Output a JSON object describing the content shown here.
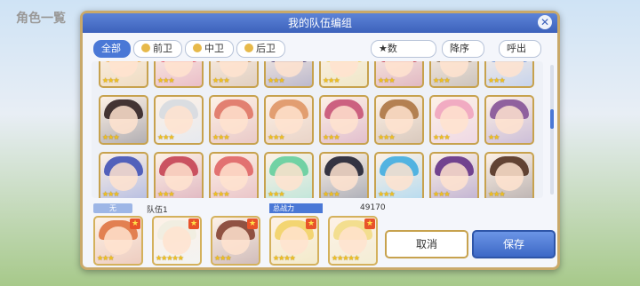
{
  "background": {
    "title": "角色一覧"
  },
  "dialog": {
    "title": "我的队伍编组",
    "filters": [
      {
        "label": "全部",
        "active": true
      },
      {
        "label": "前卫",
        "active": false
      },
      {
        "label": "中卫",
        "active": false
      },
      {
        "label": "后卫",
        "active": false
      }
    ],
    "sort_field": "★数",
    "sort_order": "降序",
    "call_label": "呼出"
  },
  "grid": {
    "rows": [
      [
        {
          "hair": "#f0b35a",
          "stars": "★★★"
        },
        {
          "hair": "#e25a6b",
          "stars": "★★★"
        },
        {
          "hair": "#c78c55",
          "stars": "★★★"
        },
        {
          "hair": "#5a4a78",
          "stars": "★★★"
        },
        {
          "hair": "#f2d36b",
          "stars": "★★★"
        },
        {
          "hair": "#c7495a",
          "stars": "★★★"
        },
        {
          "hair": "#8a6a4a",
          "stars": "★★★"
        },
        {
          "hair": "#7a9ad6",
          "stars": "★★★"
        }
      ],
      [
        {
          "hair": "#3a2a2a",
          "stars": "★★★"
        },
        {
          "hair": "#d8dbe0",
          "stars": "★★★"
        },
        {
          "hair": "#e07a6a",
          "stars": "★★★"
        },
        {
          "hair": "#e09a6a",
          "stars": "★★★"
        },
        {
          "hair": "#c95a7a",
          "stars": "★★★"
        },
        {
          "hair": "#b07a4a",
          "stars": "★★★"
        },
        {
          "hair": "#f0a8c0",
          "stars": "★★★"
        },
        {
          "hair": "#8a5a9a",
          "stars": "★★"
        }
      ],
      [
        {
          "hair": "#4a5ab8",
          "stars": "★★★"
        },
        {
          "hair": "#c74a5a",
          "stars": "★★★"
        },
        {
          "hair": "#e06a6a",
          "stars": "★★★"
        },
        {
          "hair": "#6ad0a0",
          "stars": "★★★"
        },
        {
          "hair": "#2a2a3a",
          "stars": "★★★"
        },
        {
          "hair": "#4ab0e0",
          "stars": "★★★"
        },
        {
          "hair": "#6a3a8a",
          "stars": "★★★"
        },
        {
          "hair": "#5a3a2a",
          "stars": "★★★"
        }
      ]
    ]
  },
  "team": {
    "badge": "无",
    "name": "队伍1",
    "power_label": "总战力",
    "power_value": "49170",
    "members": [
      {
        "hair": "#e07a4a",
        "stars": "★★★"
      },
      {
        "hair": "#f0ede0",
        "stars": "★★★★★"
      },
      {
        "hair": "#8a4a3a",
        "stars": "★★★"
      },
      {
        "hair": "#f2d36b",
        "stars": "★★★★"
      },
      {
        "hair": "#f2dc8a",
        "stars": "★★★★★"
      }
    ]
  },
  "buttons": {
    "cancel": "取消",
    "save": "保存"
  }
}
